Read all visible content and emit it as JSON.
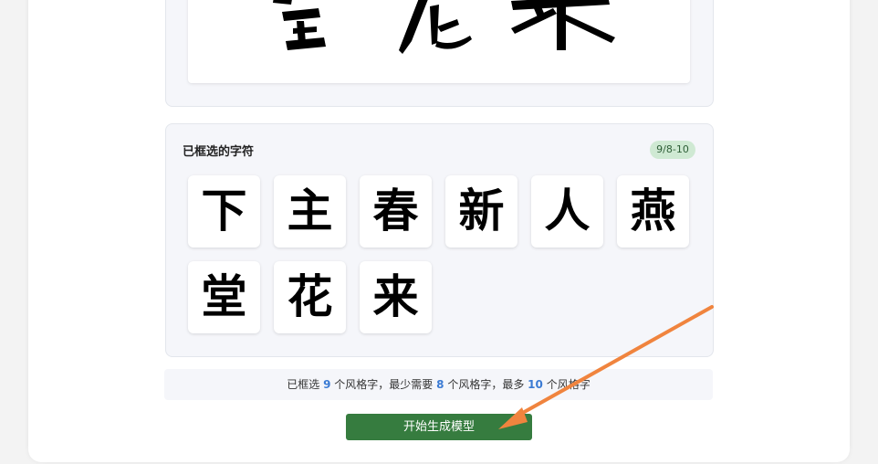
{
  "selected": {
    "title": "已框选的字符",
    "badge": "9/8-10",
    "chars": [
      "下",
      "主",
      "春",
      "新",
      "人",
      "燕",
      "堂",
      "花",
      "来"
    ]
  },
  "preview": {
    "chars": [
      "堂",
      "花",
      "来"
    ]
  },
  "info": {
    "prefix": "已框选",
    "selected_count": "9",
    "mid1": "个风格字，最少需要",
    "min_count": "8",
    "mid2": "个风格字，最多",
    "max_count": "10",
    "suffix": "个风格字"
  },
  "actions": {
    "start_label": "开始生成模型"
  },
  "colors": {
    "accent": "#367c3f",
    "badge_bg": "#cfe9d3",
    "count_blue": "#3b7bd4",
    "arrow": "#f0843e"
  }
}
